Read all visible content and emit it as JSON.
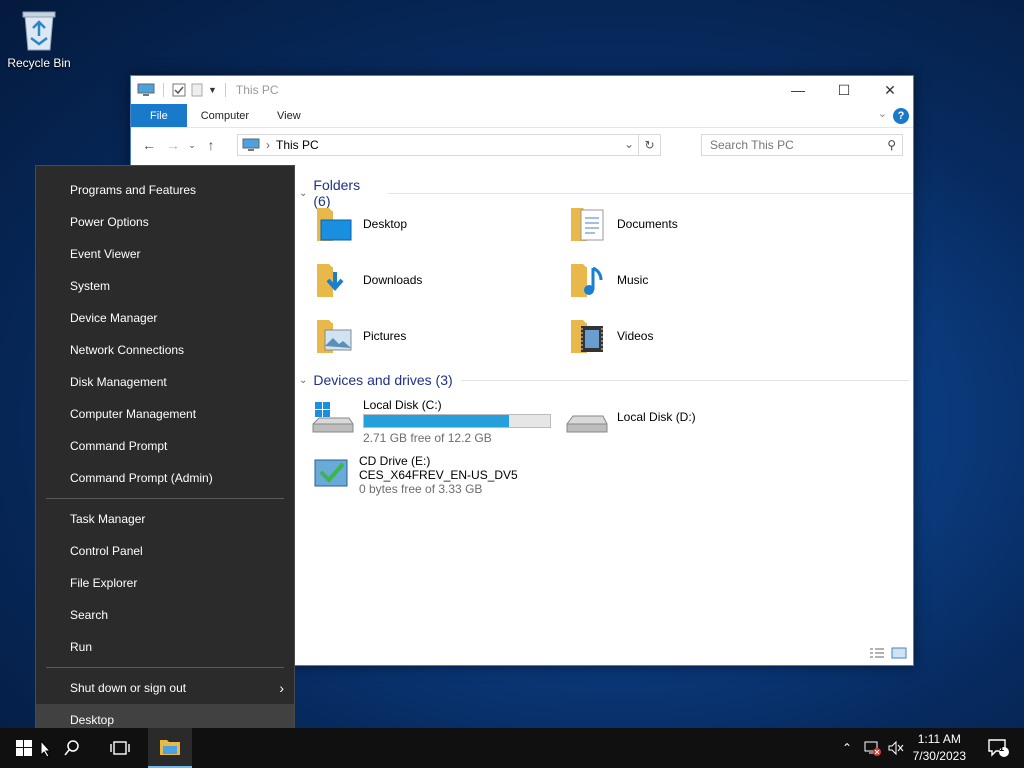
{
  "desktop": {
    "icons": [
      {
        "label": "Recycle Bin",
        "icon": "recycle-bin-icon"
      }
    ]
  },
  "window": {
    "title": "This PC",
    "ribbon_tabs": [
      "File",
      "Computer",
      "View"
    ],
    "address": "This PC",
    "search_placeholder": "Search This PC",
    "folders_header": "Folders (6)",
    "folders": [
      {
        "name": "Desktop",
        "icon": "desktop-folder-icon"
      },
      {
        "name": "Documents",
        "icon": "documents-folder-icon"
      },
      {
        "name": "Downloads",
        "icon": "downloads-folder-icon"
      },
      {
        "name": "Music",
        "icon": "music-folder-icon"
      },
      {
        "name": "Pictures",
        "icon": "pictures-folder-icon"
      },
      {
        "name": "Videos",
        "icon": "videos-folder-icon"
      }
    ],
    "drives_header": "Devices and drives (3)",
    "drives": [
      {
        "name": "Local Disk (C:)",
        "free": "2.71 GB free of 12.2 GB",
        "used_fraction": 0.78,
        "icon": "windows-drive-icon"
      },
      {
        "name": "Local Disk (D:)",
        "icon": "hard-drive-icon"
      },
      {
        "name": "CD Drive (E:)",
        "label": "CES_X64FREV_EN-US_DV5",
        "free": "0 bytes free of 3.33 GB",
        "icon": "cd-drive-icon"
      }
    ],
    "accent": "#1979ca"
  },
  "context_menu": {
    "group1": [
      "Programs and Features",
      "Power Options",
      "Event Viewer",
      "System",
      "Device Manager",
      "Network Connections",
      "Disk Management",
      "Computer Management",
      "Command Prompt",
      "Command Prompt (Admin)"
    ],
    "group2": [
      "Task Manager",
      "Control Panel",
      "File Explorer",
      "Search",
      "Run"
    ],
    "group3": [
      "Shut down or sign out",
      "Desktop"
    ],
    "highlighted": "Desktop"
  },
  "taskbar": {
    "time": "1:11 AM",
    "date": "7/30/2023",
    "notification_count": "1"
  }
}
